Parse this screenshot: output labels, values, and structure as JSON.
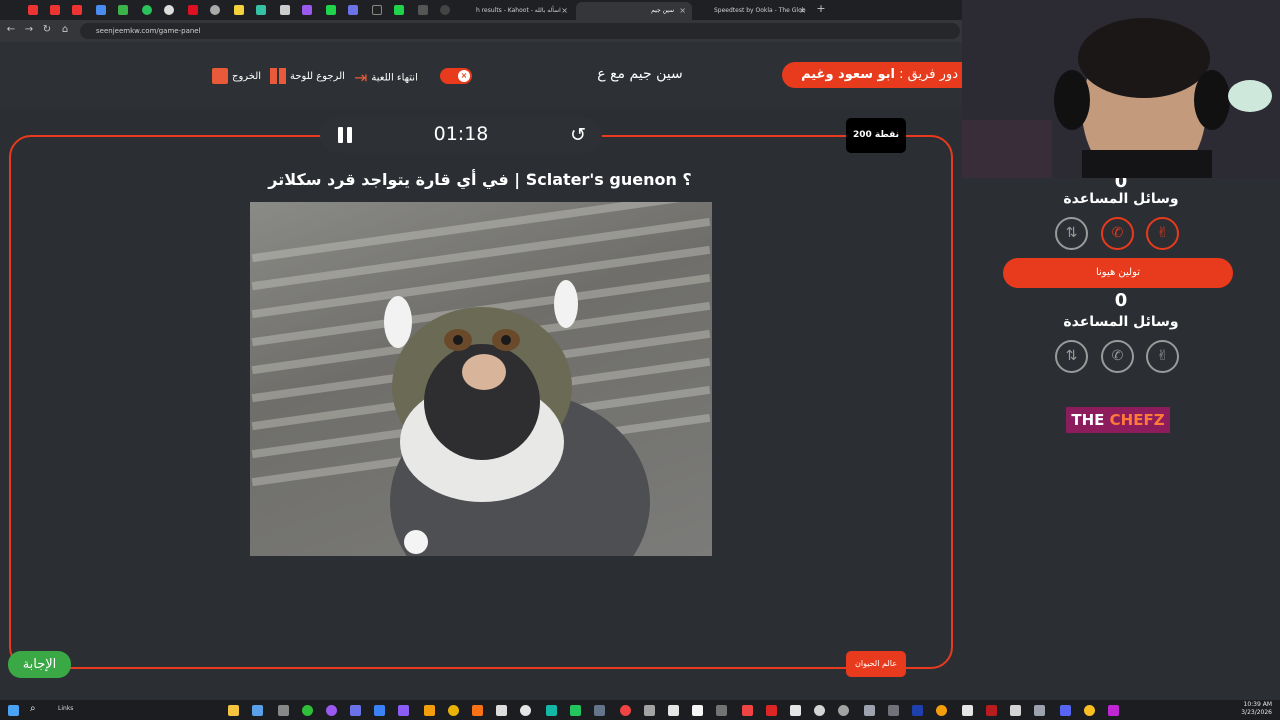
{
  "browser": {
    "tabs": [
      {
        "label": "h results - Kahoot - اسأله بالله",
        "active": false
      },
      {
        "label": "سين جيم",
        "active": true
      },
      {
        "label": "Speedtest by Ookla - The Glob",
        "active": false
      }
    ],
    "url": "seenjeemkw.com/game-panel"
  },
  "header": {
    "exit_label": "الخروج",
    "back_label": "الرجوع للوحة",
    "end_game_label": "انتهاء اللعبة",
    "game_title": "سين جيم مع ع",
    "turn_prefix": "دور فريق :",
    "turn_team": "ابو سعود وغيم"
  },
  "board": {
    "timer": "01:18",
    "points": "200 نقطة",
    "question": "في أي قارة يتواجد قرد سكلاتر | Sclater's guenon ؟",
    "answer_label": "الإجابة",
    "category_label": "عالم الحيوان"
  },
  "teams": [
    {
      "name": "ابو سعود وغيم",
      "score": "0",
      "aids_label": "وسائل المساعدة"
    },
    {
      "name": "تولين هيونا",
      "score": "0",
      "aids_label": "وسائل المساعدة"
    }
  ],
  "logo": {
    "part1": "THE ",
    "part2": "CHEFZ"
  },
  "taskbar": {
    "search_label": "Links",
    "time": "10:39 AM",
    "date": "3/23/2026"
  },
  "colors": {
    "accent": "#e83a1c",
    "answer": "#3aa845"
  }
}
